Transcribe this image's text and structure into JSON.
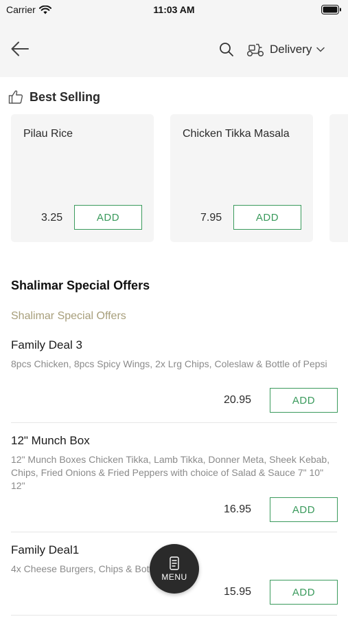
{
  "status_bar": {
    "carrier": "Carrier",
    "time": "11:03 AM"
  },
  "header": {
    "delivery_label": "Delivery"
  },
  "best_selling": {
    "title": "Best Selling",
    "items": [
      {
        "name": "Pilau Rice",
        "price": "3.25",
        "add_label": "ADD"
      },
      {
        "name": "Chicken Tikka Masala",
        "price": "7.95",
        "add_label": "ADD"
      }
    ]
  },
  "offers": {
    "title": "Shalimar Special Offers",
    "subtitle": "Shalimar Special Offers",
    "items": [
      {
        "name": "Family Deal 3",
        "description": "8pcs Chicken, 8pcs Spicy Wings, 2x Lrg Chips, Coleslaw & Bottle of Pepsi",
        "price": "20.95",
        "add_label": "ADD"
      },
      {
        "name": "12\" Munch Box",
        "description": "12\" Munch Boxes Chicken Tikka, Lamb Tikka, Donner Meta, Sheek Kebab, Chips, Fried Onions & Fried Peppers with choice of Salad & Sauce 7\" 10\" 12\"",
        "price": "16.95",
        "add_label": "ADD"
      },
      {
        "name": "Family Deal1",
        "description": "4x Cheese Burgers, Chips & Bottle of Drink",
        "price": "15.95",
        "add_label": "ADD"
      }
    ]
  },
  "menu_fab": {
    "label": "MENU"
  },
  "colors": {
    "accent_green": "#3a9a5c",
    "subtitle_gold": "#a79e7a",
    "header_bg": "#f5f5f5",
    "fab_bg": "#2a2a2a"
  }
}
